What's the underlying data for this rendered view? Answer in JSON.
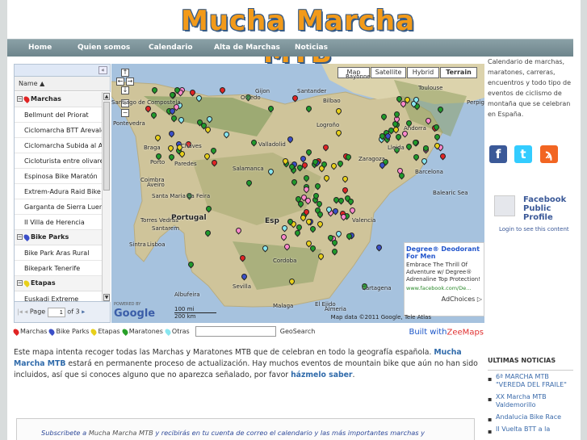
{
  "site_title": "Mucha Marcha MTB",
  "nav": [
    "Home",
    "Quien somos",
    "Calendario",
    "Alta de Marchas",
    "Noticias"
  ],
  "sidebar": {
    "collapse_glyph": "«",
    "column_header": "Name ▲",
    "groups": [
      {
        "label": "Marchas",
        "color": "#e02424",
        "items": [
          "Bellmunt del Priorat",
          "Ciclomarcha BTT Arevalo",
          "Ciclomarcha Subida al Al...",
          "Cicloturista entre olivares",
          "Espinosa Bike Maratón",
          "Extrem-Adura Raid Bike",
          "Garganta de Sierra Luen...",
          "II Villa de Herencia"
        ]
      },
      {
        "label": "Bike Parks",
        "color": "#3b4fc8",
        "items": [
          "Bike Park Aras Rural",
          "Bikepark Tenerife"
        ]
      },
      {
        "label": "Etapas",
        "color": "#e8d01a",
        "items": [
          "Euskadi Extreme"
        ]
      },
      {
        "label": "Maratones",
        "color": "#28a028",
        "items": []
      }
    ],
    "pager": {
      "page_label": "Page",
      "page_value": "1",
      "of_label": "of 3"
    }
  },
  "map": {
    "types": [
      "Map",
      "Satellite",
      "Hybrid",
      "Terrain"
    ],
    "active_type": "Terrain",
    "labels": [
      "Bayonne",
      "Toulouse",
      "Perpignan",
      "Barcelona",
      "Bilbao",
      "Santander",
      "Oviedo",
      "Gijon",
      "Santiago de Compostela",
      "Pontevedra",
      "Braga",
      "Porto",
      "Aveiro",
      "Coimbra",
      "Santa Maria da Feira",
      "Torres Vedras",
      "Santarem",
      "Sintra",
      "Lisboa",
      "Portugal",
      "Chaves",
      "Paredes",
      "Valladolid",
      "Logroño",
      "Salamanca",
      "Zaragoza",
      "Lleida",
      "Balearic Sea",
      "Valencia",
      "Cartagena",
      "Sevilla",
      "Malaga",
      "Almeria",
      "Andorra",
      "Albufeira",
      "El Ejido",
      "Cordoba",
      "Esp"
    ],
    "ad": {
      "title": "Degree® Deodorant For Men",
      "body": "Embrace The Thrill Of Adventure w/ Degree® Adrenaline Top Protection!",
      "url": "www.facebook.com/De...",
      "choices": "AdChoices ▷"
    },
    "copyright": "Map data ©2011 Google, Tele Atlas",
    "scale": [
      "100 mi",
      "200 km"
    ],
    "google_logo": "Google",
    "powered_by": "POWERED BY"
  },
  "legend": {
    "items": [
      {
        "label": "Marchas",
        "color": "#e02424"
      },
      {
        "label": "Bike Parks",
        "color": "#3b4fc8"
      },
      {
        "label": "Etapas",
        "color": "#e8d01a"
      },
      {
        "label": "Maratones",
        "color": "#28a028"
      },
      {
        "label": "Otras",
        "color": "#88e6f0"
      }
    ],
    "search_label": "GeoSearch",
    "built_with": "Built with ",
    "built_brand": "ZeeMaps"
  },
  "description": {
    "part1": "Este mapa intenta recoger todas las Marchas y Maratones MTB que de celebran en todo la geografía española. ",
    "brand": "Mucha Marcha MTB",
    "part2": " estará en permanente proceso de actualización. Hay muchos eventos de mountain bike que aún no han sido incluidos, así que si conoces alguno que no aparezca señalado, por favor ",
    "link": "házmelo saber",
    "part3": "."
  },
  "subscribe": {
    "part1": "Subscribete a ",
    "brand": "Mucha Marcha MTB",
    "part2": " y recibirás en tu cuenta de correo el calendario y las más importantes marchas y"
  },
  "right": {
    "intro": "Calendario de marchas, maratones, carreras, encuentros y todo tipo de eventos de ciclismo de montaña que se celebran en España.",
    "social": [
      {
        "name": "facebook",
        "glyph": "f",
        "color": "#3b5998"
      },
      {
        "name": "twitter",
        "glyph": "t",
        "color": "#33ccff"
      },
      {
        "name": "rss",
        "glyph": "ϡ",
        "color": "#f26522"
      }
    ],
    "fb_name": "Facebook Public Profile",
    "fb_login": "Login to see this content",
    "news_heading": "ULTIMAS NOTICIAS",
    "news": [
      "6ª MARCHA MTB \"VEREDA DEL FRAILE\"",
      "XX Marcha MTB Valdemorillo",
      "Andalucia Bike Race",
      "II Vuelta BTT a la"
    ]
  }
}
